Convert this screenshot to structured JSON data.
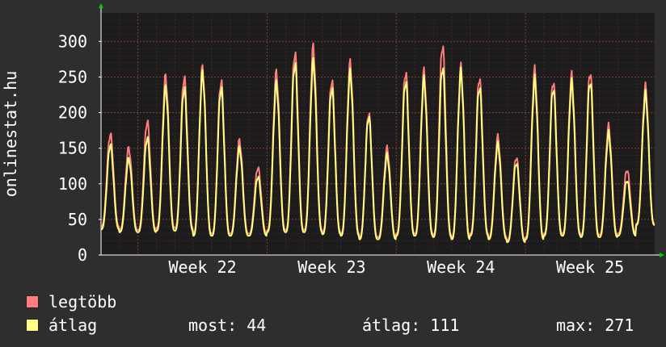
{
  "chart_data": {
    "type": "line",
    "ylabel": "onlinestat.hu",
    "ylim": [
      0,
      340
    ],
    "y_ticks": [
      0,
      50,
      100,
      150,
      200,
      250,
      300
    ],
    "x_tick_labels": [
      "Week 22",
      "Week 23",
      "Week 24",
      "Week 25"
    ],
    "grid": true,
    "colors": {
      "background": "#2e2e2e",
      "plot": "#1c1c1c",
      "grid_minor": "#5a2a2a",
      "grid_major": "#8a3a3a",
      "axis": "#ffffff",
      "arrow": "#00cc00"
    },
    "series": [
      {
        "name": "legtöbb",
        "color": "#ff7d7d",
        "daily": [
          {
            "peak": 170,
            "low": 40
          },
          {
            "peak": 150,
            "low": 35
          },
          {
            "peak": 188,
            "low": 35
          },
          {
            "peak": 250,
            "low": 38
          },
          {
            "peak": 250,
            "low": 38
          },
          {
            "peak": 262,
            "low": 30
          },
          {
            "peak": 245,
            "low": 30
          },
          {
            "peak": 160,
            "low": 30
          },
          {
            "peak": 123,
            "low": 30
          },
          {
            "peak": 255,
            "low": 35
          },
          {
            "peak": 285,
            "low": 35
          },
          {
            "peak": 290,
            "low": 35
          },
          {
            "peak": 246,
            "low": 32
          },
          {
            "peak": 268,
            "low": 30
          },
          {
            "peak": 200,
            "low": 25
          },
          {
            "peak": 150,
            "low": 25
          },
          {
            "peak": 258,
            "low": 30
          },
          {
            "peak": 256,
            "low": 30
          },
          {
            "peak": 296,
            "low": 28
          },
          {
            "peak": 262,
            "low": 25
          },
          {
            "peak": 250,
            "low": 30
          },
          {
            "peak": 165,
            "low": 25
          },
          {
            "peak": 138,
            "low": 20
          },
          {
            "peak": 258,
            "low": 25
          },
          {
            "peak": 245,
            "low": 30
          },
          {
            "peak": 250,
            "low": 30
          },
          {
            "peak": 258,
            "low": 28
          },
          {
            "peak": 180,
            "low": 28
          },
          {
            "peak": 120,
            "low": 30
          },
          {
            "peak": 235,
            "low": 44
          }
        ]
      },
      {
        "name": "átlag",
        "color": "#ffff80",
        "daily": [
          {
            "peak": 155,
            "low": 36
          },
          {
            "peak": 135,
            "low": 32
          },
          {
            "peak": 165,
            "low": 32
          },
          {
            "peak": 235,
            "low": 34
          },
          {
            "peak": 235,
            "low": 34
          },
          {
            "peak": 255,
            "low": 27
          },
          {
            "peak": 235,
            "low": 27
          },
          {
            "peak": 150,
            "low": 27
          },
          {
            "peak": 110,
            "low": 27
          },
          {
            "peak": 240,
            "low": 32
          },
          {
            "peak": 270,
            "low": 32
          },
          {
            "peak": 270,
            "low": 32
          },
          {
            "peak": 235,
            "low": 29
          },
          {
            "peak": 255,
            "low": 27
          },
          {
            "peak": 195,
            "low": 22
          },
          {
            "peak": 140,
            "low": 22
          },
          {
            "peak": 245,
            "low": 27
          },
          {
            "peak": 245,
            "low": 27
          },
          {
            "peak": 265,
            "low": 25
          },
          {
            "peak": 255,
            "low": 22
          },
          {
            "peak": 237,
            "low": 27
          },
          {
            "peak": 155,
            "low": 22
          },
          {
            "peak": 130,
            "low": 18
          },
          {
            "peak": 245,
            "low": 22
          },
          {
            "peak": 235,
            "low": 27
          },
          {
            "peak": 240,
            "low": 27
          },
          {
            "peak": 245,
            "low": 25
          },
          {
            "peak": 170,
            "low": 25
          },
          {
            "peak": 105,
            "low": 27
          },
          {
            "peak": 225,
            "low": 42
          }
        ]
      }
    ]
  },
  "legend": {
    "items": [
      {
        "label": "legtöbb",
        "color": "#ff7d7d"
      },
      {
        "label": "átlag",
        "color": "#ffff80"
      }
    ]
  },
  "stats": {
    "most": "most: 44",
    "atlag": "átlag: 111",
    "max": "max: 271"
  }
}
